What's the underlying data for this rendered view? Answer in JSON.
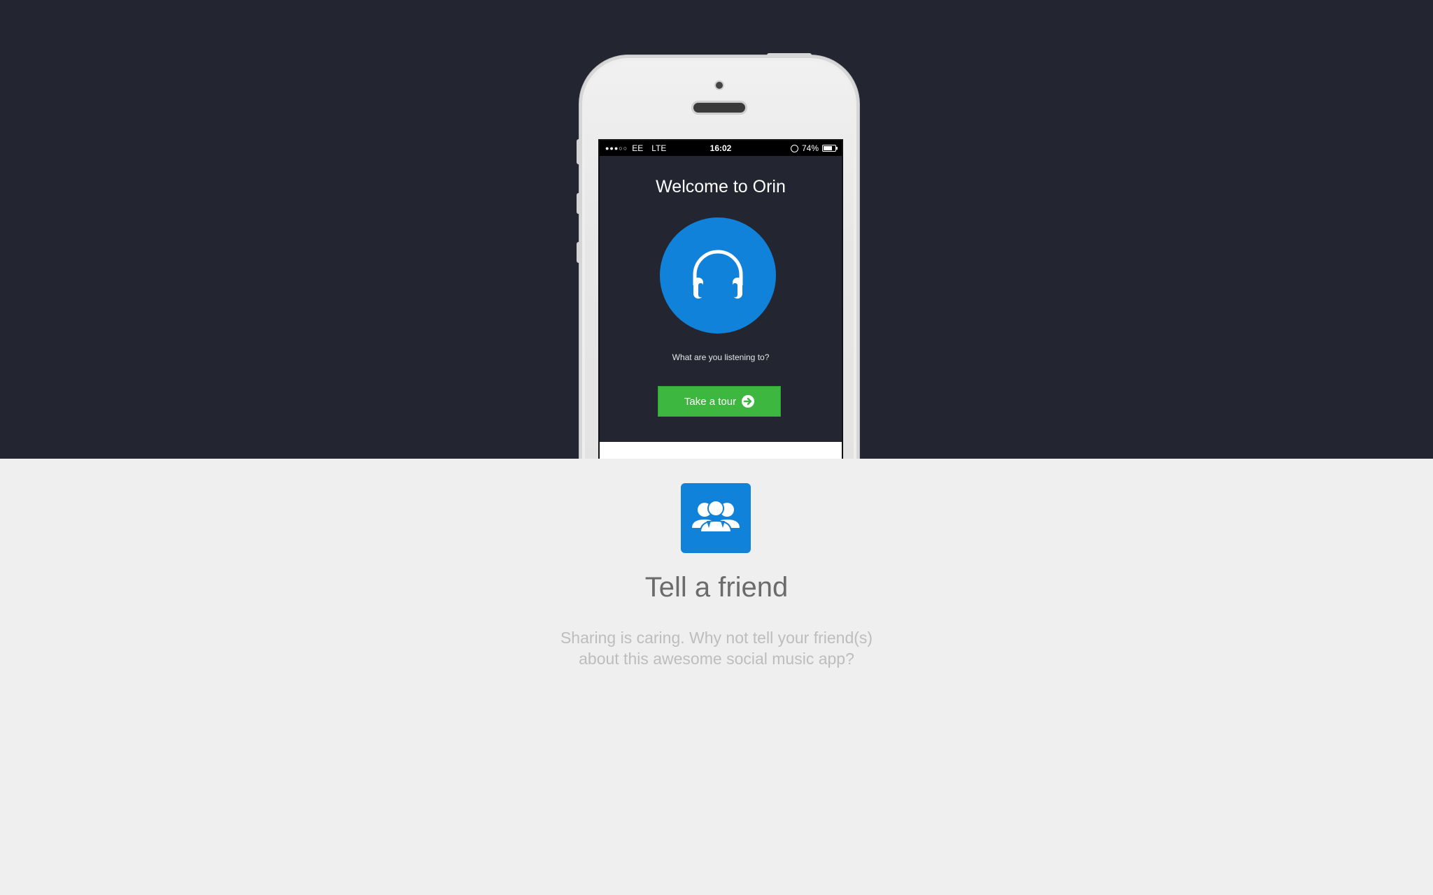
{
  "status_bar": {
    "carrier": "EE",
    "network": "LTE",
    "time": "16:02",
    "battery": "74%",
    "signal_icon": "signal-dots-icon",
    "alarm_icon": "alarm-clock-icon",
    "battery_level": 0.74
  },
  "app": {
    "welcome_title": "Welcome to Orin",
    "tagline": "What are you listening to?",
    "tour_button_label": "Take a tour",
    "hero_icon": "headphones-icon",
    "accent_color": "#1182d9",
    "button_color": "#3db73f"
  },
  "section": {
    "icon": "group-icon",
    "title": "Tell a friend",
    "description_line1": "Sharing is caring. Why not tell your friend(s)",
    "description_line2": "about this awesome social music app?"
  },
  "colors": {
    "hero_background": "#232631",
    "page_background": "#efefef"
  }
}
